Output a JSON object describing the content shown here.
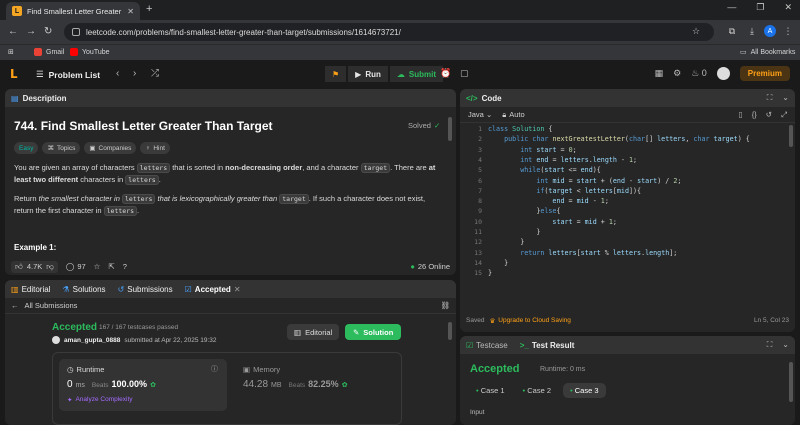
{
  "browser": {
    "tab_title": "Find Smallest Letter Greater Th",
    "url": "leetcode.com/problems/find-smallest-letter-greater-than-target/submissions/1614673721/",
    "bookmarks": [
      "Gmail",
      "YouTube"
    ],
    "all_bookmarks": "All Bookmarks",
    "profile_letter": "A"
  },
  "topbar": {
    "problem_list": "Problem List",
    "run": "Run",
    "submit": "Submit",
    "streak": "0",
    "premium": "Premium"
  },
  "description": {
    "tab": "Description",
    "title": "744. Find Smallest Letter Greater Than Target",
    "solved": "Solved",
    "tags": [
      "Easy",
      "Topics",
      "Companies",
      "Hint"
    ],
    "p1_a": "You are given an array of characters ",
    "p1_code1": "letters",
    "p1_b": " that is sorted in ",
    "p1_bold1": "non-decreasing order",
    "p1_c": ", and a character ",
    "p1_code2": "target",
    "p1_d": ". There are ",
    "p1_bold2": "at least two different",
    "p1_e": " characters in ",
    "p1_code3": "letters",
    "p1_f": ".",
    "p2_a": "Return ",
    "p2_it1": "the smallest character in",
    "p2_code1": "letters",
    "p2_it2": "that is lexicographically greater than",
    "p2_code2": "target",
    "p2_b": ". If such a character does not exist, return the first character in ",
    "p2_code3": "letters",
    "p2_c": ".",
    "example": "Example 1:",
    "likes": "4.7K",
    "comments": "97",
    "online": "26 Online"
  },
  "submission": {
    "tabs": [
      "Editorial",
      "Solutions",
      "Submissions",
      "Accepted"
    ],
    "back": "All Submissions",
    "status": "Accepted",
    "testcases": "167 / 167 testcases passed",
    "user": "aman_gupta_0888",
    "submitted_at": "submitted at Apr 22, 2025 19:32",
    "editorial_btn": "Editorial",
    "solution_btn": "Solution",
    "runtime_label": "Runtime",
    "runtime_value": "0",
    "runtime_unit": "ms",
    "beats_label": "Beats",
    "runtime_beats": "100.00%",
    "analyze": "Analyze Complexity",
    "memory_label": "Memory",
    "memory_value": "44.28",
    "memory_unit": "MB",
    "memory_beats": "82.25%"
  },
  "code": {
    "tab": "Code",
    "language": "Java",
    "mode": "Auto",
    "line_numbers": [
      "1",
      "2",
      "3",
      "4",
      "5",
      "6",
      "7",
      "8",
      "9",
      "10",
      "11",
      "12",
      "13",
      "14",
      "15"
    ],
    "saved": "Saved",
    "upgrade": "Upgrade to Cloud Saving",
    "cursor": "Ln 5, Col 23"
  },
  "testpanel": {
    "testcase_tab": "Testcase",
    "result_tab": "Test Result",
    "status": "Accepted",
    "runtime": "Runtime: 0 ms",
    "cases": [
      "Case 1",
      "Case 2",
      "Case 3"
    ],
    "input_label": "Input"
  },
  "colors": {
    "accent_orange": "#ffa116",
    "green": "#2cbb5d",
    "panel": "#262626"
  }
}
